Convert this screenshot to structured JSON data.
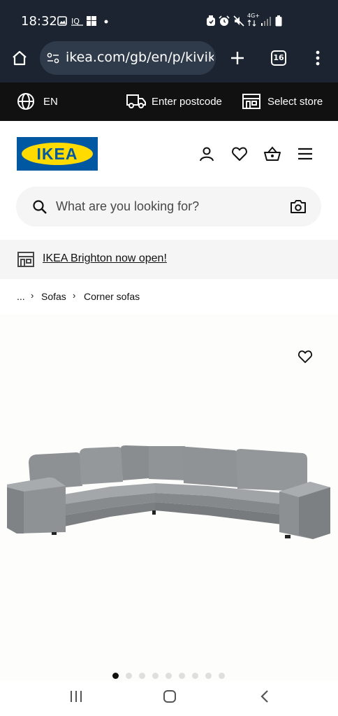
{
  "status_bar": {
    "time": "18:32",
    "indicators": [
      "gallery-icon",
      "iq-icon",
      "windows-icon",
      "dot-icon",
      "alarm-icon",
      "alarm-clock-icon",
      "mute-icon",
      "network-4g-icon",
      "signal-icon",
      "battery-icon"
    ],
    "network_label": "4G+"
  },
  "browser": {
    "url": "ikea.com/gb/en/p/kivik-c",
    "tab_count": "16"
  },
  "top_bar": {
    "language": "EN",
    "postcode_label": "Enter postcode",
    "store_label": "Select store"
  },
  "header": {
    "logo_text": "IKEA",
    "search_placeholder": "What are you looking for?"
  },
  "announcement": {
    "text": "IKEA Brighton now open!"
  },
  "breadcrumb": {
    "ellipsis": "...",
    "items": [
      "Sofas",
      "Corner sofas"
    ]
  },
  "carousel": {
    "total_dots": 9,
    "active_index": 0
  },
  "colors": {
    "status_bg": "#1b2430",
    "ikea_top_bg": "#111111",
    "ikea_blue": "#0058a3",
    "ikea_yellow": "#ffdb00",
    "sofa_grey": "#8f9396"
  }
}
